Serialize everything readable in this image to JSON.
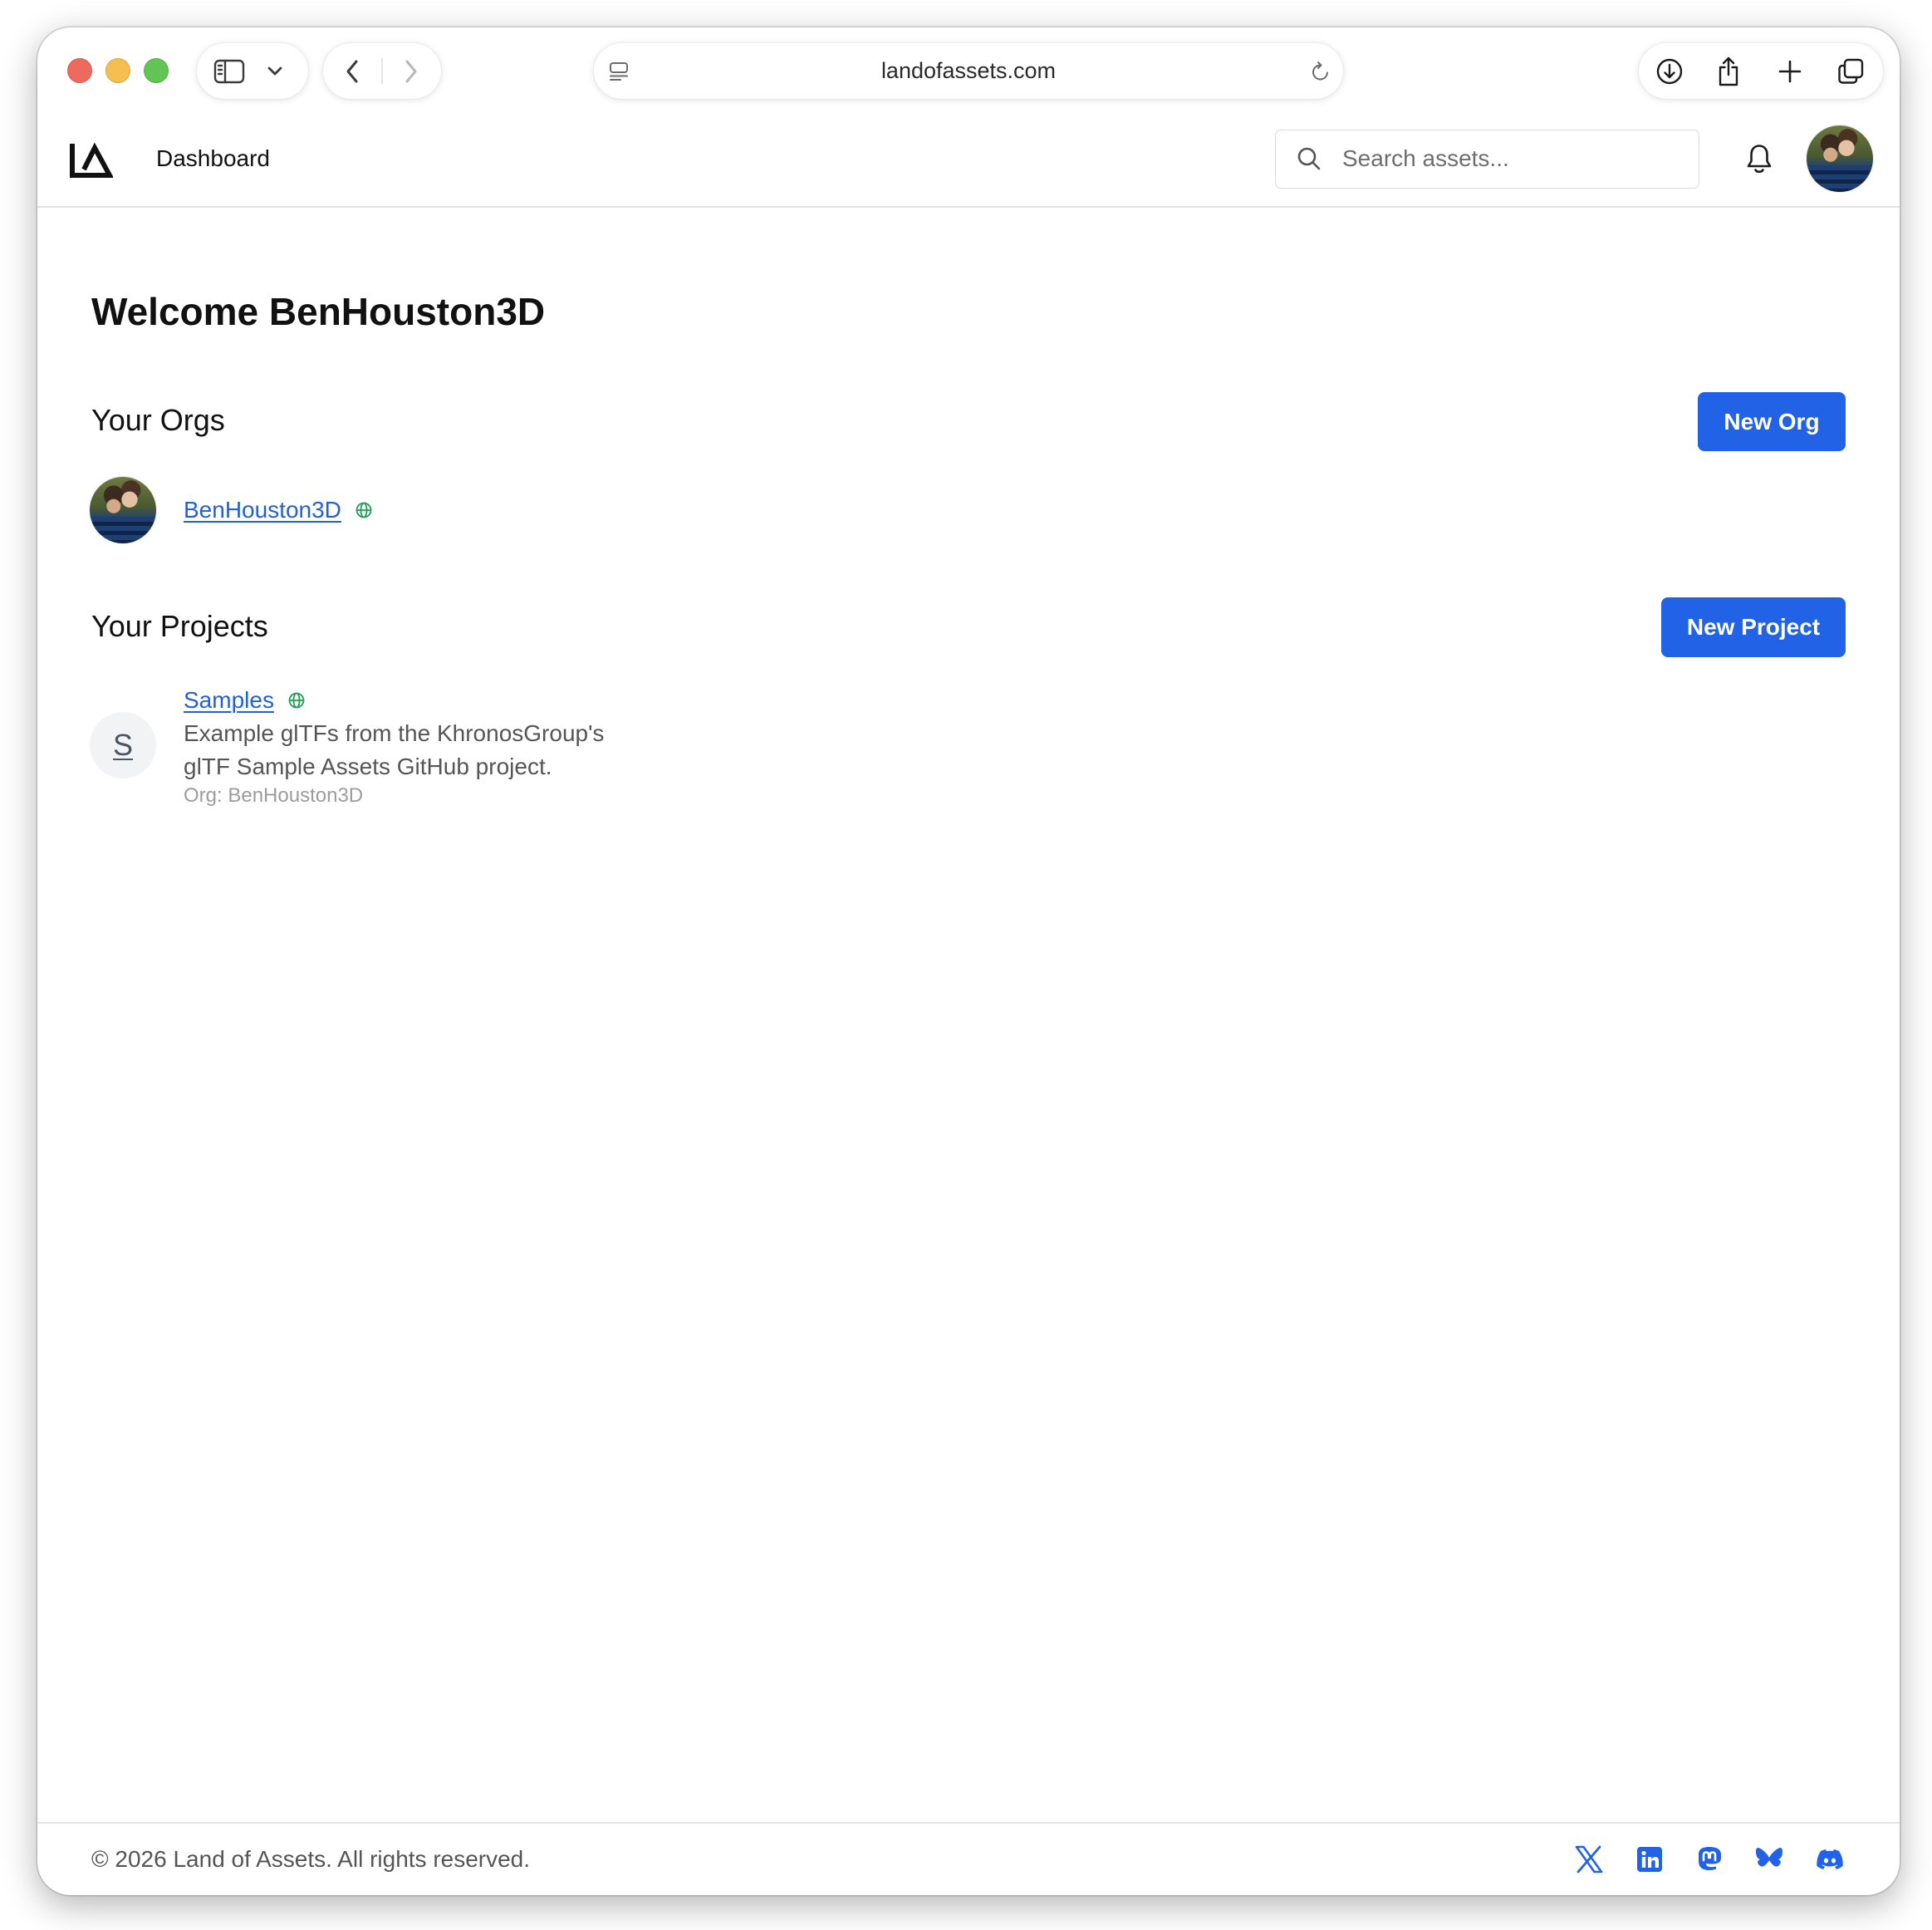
{
  "browser": {
    "traffic_lights": [
      "close-icon",
      "minimize-icon",
      "zoom-icon"
    ],
    "toolbar_icons": {
      "sidebar": "sidebar-icon",
      "sidebar_menu": "chevron-down-icon",
      "back": "chevron-left-icon",
      "forward": "chevron-right-icon",
      "page_menu": "page-menu-icon",
      "reload": "reload-icon",
      "downloads": "download-icon",
      "share": "share-icon",
      "new_tab": "plus-icon",
      "tab_overview": "tabs-icon"
    },
    "address_bar": {
      "url": "landofassets.com"
    }
  },
  "header": {
    "logo_icon": "logo-icon",
    "nav": {
      "dashboard": "Dashboard"
    },
    "search": {
      "placeholder": "Search assets...",
      "icon": "search-icon"
    },
    "notifications_icon": "bell-icon"
  },
  "main": {
    "welcome": "Welcome BenHouston3D",
    "orgs": {
      "title": "Your Orgs",
      "new_button": "New Org",
      "items": [
        {
          "name": "BenHouston3D",
          "visibility_icon": "globe-icon"
        }
      ]
    },
    "projects": {
      "title": "Your Projects",
      "new_button": "New Project",
      "items": [
        {
          "initial": "S",
          "name": "Samples",
          "visibility_icon": "globe-icon",
          "description": "Example glTFs from the KhronosGroup's glTF Sample Assets GitHub project.",
          "org": "Org: BenHouston3D"
        }
      ]
    }
  },
  "footer": {
    "copyright": "© 2026 Land of Assets. All rights reserved.",
    "social": [
      {
        "icon": "x-icon"
      },
      {
        "icon": "linkedin-icon"
      },
      {
        "icon": "mastodon-icon"
      },
      {
        "icon": "bluesky-icon"
      },
      {
        "icon": "discord-icon"
      }
    ]
  },
  "colors": {
    "accent": "#2262e6",
    "link": "#2160d8",
    "public_globe": "#1f9d55",
    "traffic_close": "#ee6a5f",
    "traffic_minimize": "#f5be4f",
    "traffic_zoom": "#61c454"
  }
}
